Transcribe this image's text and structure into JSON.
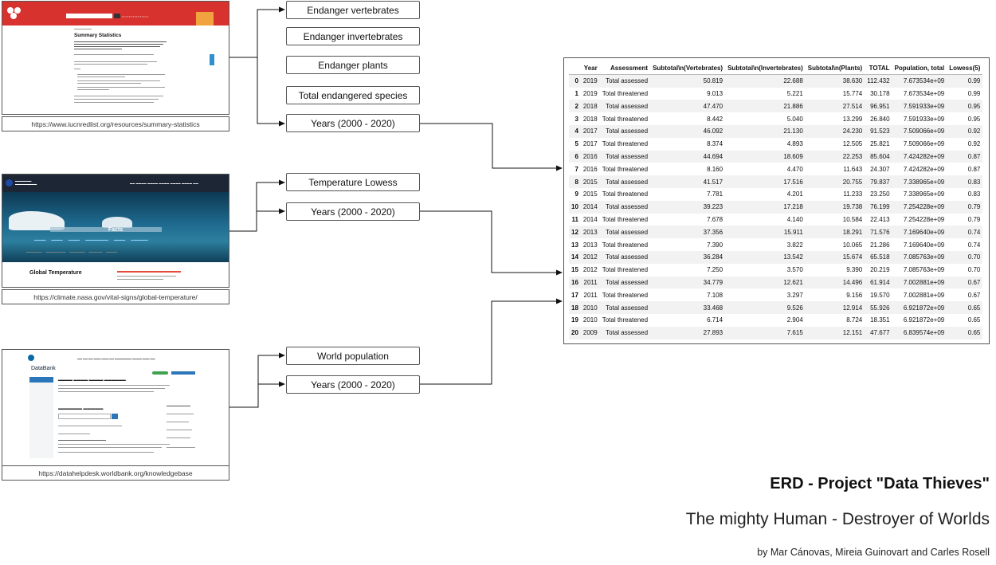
{
  "sources": [
    {
      "url": "https://www.iucnredlist.org/resources/summary-statistics",
      "page_title": "Summary Statistics",
      "variables": [
        "Endanger vertebrates",
        "Endanger invertebrates",
        "Endanger plants",
        "Total endangered species",
        "Years (2000 - 2020)"
      ]
    },
    {
      "url": "https://climate.nasa.gov/vital-signs/global-temperature/",
      "hero_title": "Facts",
      "page_title": "Global Temperature",
      "variables": [
        "Temperature Lowess",
        "Years (2000 - 2020)"
      ]
    },
    {
      "url": "https://datahelpdesk.worldbank.org/knowledgebase",
      "app_title": "DataBank",
      "variables": [
        "World population",
        "Years (2000 - 2020)"
      ]
    }
  ],
  "table": {
    "columns": [
      "",
      "Year",
      "Assessment",
      "Subtotal\\n(Vertebrates)",
      "Subtotal\\n(Invertebrates)",
      "Subtotal\\n(Plants)",
      "TOTAL",
      "Population, total",
      "Lowess(5)"
    ],
    "rows": [
      [
        "0",
        "2019",
        "Total assessed",
        "50.819",
        "22.688",
        "38.630",
        "112.432",
        "7.673534e+09",
        "0.99"
      ],
      [
        "1",
        "2019",
        "Total threatened",
        "9.013",
        "5.221",
        "15.774",
        "30.178",
        "7.673534e+09",
        "0.99"
      ],
      [
        "2",
        "2018",
        "Total assessed",
        "47.470",
        "21.886",
        "27.514",
        "96.951",
        "7.591933e+09",
        "0.95"
      ],
      [
        "3",
        "2018",
        "Total threatened",
        "8.442",
        "5.040",
        "13.299",
        "26.840",
        "7.591933e+09",
        "0.95"
      ],
      [
        "4",
        "2017",
        "Total assessed",
        "46.092",
        "21.130",
        "24.230",
        "91.523",
        "7.509066e+09",
        "0.92"
      ],
      [
        "5",
        "2017",
        "Total threatened",
        "8.374",
        "4.893",
        "12.505",
        "25.821",
        "7.509066e+09",
        "0.92"
      ],
      [
        "6",
        "2016",
        "Total assessed",
        "44.694",
        "18.609",
        "22.253",
        "85.604",
        "7.424282e+09",
        "0.87"
      ],
      [
        "7",
        "2016",
        "Total threatened",
        "8.160",
        "4.470",
        "11.643",
        "24.307",
        "7.424282e+09",
        "0.87"
      ],
      [
        "8",
        "2015",
        "Total assessed",
        "41.517",
        "17.516",
        "20.755",
        "79.837",
        "7.338965e+09",
        "0.83"
      ],
      [
        "9",
        "2015",
        "Total threatened",
        "7.781",
        "4.201",
        "11.233",
        "23.250",
        "7.338965e+09",
        "0.83"
      ],
      [
        "10",
        "2014",
        "Total assessed",
        "39.223",
        "17.218",
        "19.738",
        "76.199",
        "7.254228e+09",
        "0.79"
      ],
      [
        "11",
        "2014",
        "Total threatened",
        "7.678",
        "4.140",
        "10.584",
        "22.413",
        "7.254228e+09",
        "0.79"
      ],
      [
        "12",
        "2013",
        "Total assessed",
        "37.356",
        "15.911",
        "18.291",
        "71.576",
        "7.169640e+09",
        "0.74"
      ],
      [
        "13",
        "2013",
        "Total threatened",
        "7.390",
        "3.822",
        "10.065",
        "21.286",
        "7.169640e+09",
        "0.74"
      ],
      [
        "14",
        "2012",
        "Total assessed",
        "36.284",
        "13.542",
        "15.674",
        "65.518",
        "7.085763e+09",
        "0.70"
      ],
      [
        "15",
        "2012",
        "Total threatened",
        "7.250",
        "3.570",
        "9.390",
        "20.219",
        "7.085763e+09",
        "0.70"
      ],
      [
        "16",
        "2011",
        "Total assessed",
        "34.779",
        "12.621",
        "14.496",
        "61.914",
        "7.002881e+09",
        "0.67"
      ],
      [
        "17",
        "2011",
        "Total threatened",
        "7.108",
        "3.297",
        "9.156",
        "19.570",
        "7.002881e+09",
        "0.67"
      ],
      [
        "18",
        "2010",
        "Total assessed",
        "33.468",
        "9.526",
        "12.914",
        "55.926",
        "6.921872e+09",
        "0.65"
      ],
      [
        "19",
        "2010",
        "Total threatened",
        "6.714",
        "2.904",
        "8.724",
        "18.351",
        "6.921872e+09",
        "0.65"
      ],
      [
        "20",
        "2009",
        "Total assessed",
        "27.893",
        "7.615",
        "12.151",
        "47.677",
        "6.839574e+09",
        "0.65"
      ]
    ]
  },
  "titles": {
    "main": "ERD - Project \"Data Thieves\"",
    "subtitle": "The mighty Human - Destroyer of Worlds",
    "authors": "by Mar Cánovas, Mireia Guinovart and Carles Rosell"
  }
}
